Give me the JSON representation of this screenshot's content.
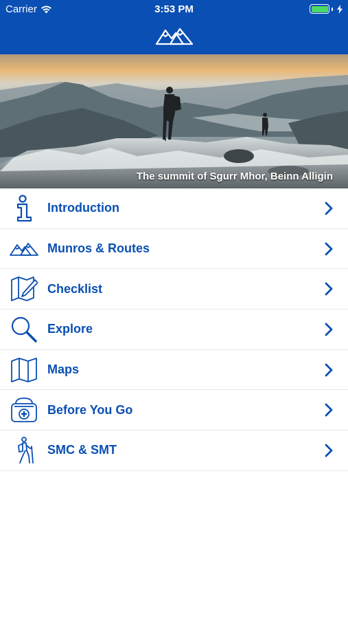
{
  "status_bar": {
    "carrier": "Carrier",
    "time": "3:53 PM"
  },
  "header": {
    "logo_icon": "mountains-logo-icon"
  },
  "hero": {
    "caption": "The summit of Sgurr Mhor, Beinn Alligin"
  },
  "menu": {
    "items": [
      {
        "label": "Introduction",
        "icon": "info-icon"
      },
      {
        "label": "Munros & Routes",
        "icon": "mountains-icon"
      },
      {
        "label": "Checklist",
        "icon": "checklist-map-pencil-icon"
      },
      {
        "label": "Explore",
        "icon": "magnifier-icon"
      },
      {
        "label": "Maps",
        "icon": "folded-map-icon"
      },
      {
        "label": "Before You Go",
        "icon": "first-aid-kit-icon"
      },
      {
        "label": "SMC & SMT",
        "icon": "hiker-icon"
      }
    ]
  },
  "colors": {
    "brand_blue": "#0a4fb4",
    "battery_green": "#4cd964",
    "divider": "#e6e6e6"
  }
}
